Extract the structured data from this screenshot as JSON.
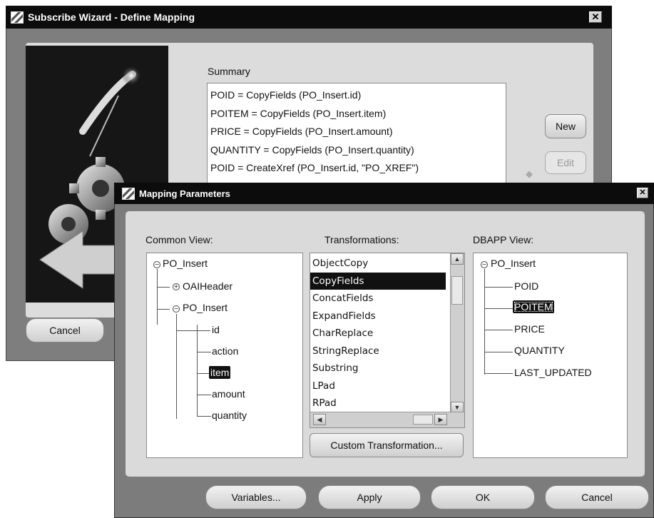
{
  "wizard": {
    "title": "Subscribe Wizard  - Define Mapping",
    "summary_label": "Summary",
    "summary_lines": [
      "POID = CopyFields (PO_Insert.id)",
      "POITEM = CopyFields (PO_Insert.item)",
      "PRICE = CopyFields (PO_Insert.amount)",
      "QUANTITY = CopyFields (PO_Insert.quantity)",
      "POID = CreateXref (PO_Insert.id, \"PO_XREF\")"
    ],
    "new_label": "New",
    "edit_label": "Edit",
    "cancel_label": "Cancel",
    "close_glyph": "✕"
  },
  "dialog": {
    "title": "Mapping Parameters",
    "close_glyph": "✕",
    "common_view": {
      "label": "Common View:",
      "root": "PO_Insert",
      "header": "OAIHeader",
      "child": "PO_Insert",
      "fields": [
        "id",
        "action",
        "item",
        "amount",
        "quantity"
      ],
      "selected": "item"
    },
    "transformations": {
      "label": "Transformations:",
      "items": [
        "ObjectCopy",
        "CopyFields",
        "ConcatFields",
        "ExpandFields",
        "CharReplace",
        "StringReplace",
        "Substring",
        "LPad",
        "RPad"
      ],
      "selected": "CopyFields",
      "custom_button": "Custom Transformation..."
    },
    "dbapp_view": {
      "label": "DBAPP View:",
      "root": "PO_Insert",
      "fields": [
        "POID",
        "POITEM",
        "PRICE",
        "QUANTITY",
        "LAST_UPDATED"
      ],
      "selected": "POITEM"
    },
    "buttons": {
      "variables": "Variables...",
      "apply": "Apply",
      "ok": "OK",
      "cancel": "Cancel"
    }
  },
  "colors": {
    "titlebar": "#0c0c0c",
    "window_frame": "#7e7e7e",
    "panel": "#dadada",
    "selection": "#111111"
  }
}
